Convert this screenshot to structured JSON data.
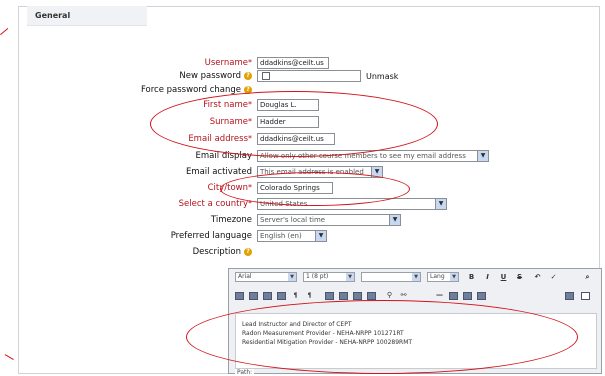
{
  "section": {
    "title": "General"
  },
  "fields": {
    "username": {
      "label": "Username",
      "value": "ddadkins@ceilt.us"
    },
    "new_password": {
      "label": "New password",
      "unmask_label": "Unmask"
    },
    "force_password_change": {
      "label": "Force password change"
    },
    "first_name": {
      "label": "First name",
      "value": "Douglas L."
    },
    "surname": {
      "label": "Surname",
      "value": "Hadder"
    },
    "email_address": {
      "label": "Email address",
      "value": "ddadkins@ceilt.us"
    },
    "email_display": {
      "label": "Email display",
      "value": "Allow only other course members to see my email address"
    },
    "email_activated": {
      "label": "Email activated",
      "value": "This email address is enabled"
    },
    "city_town": {
      "label": "City/town",
      "value": "Colorado Springs"
    },
    "country": {
      "label": "Select a country",
      "value": "United States"
    },
    "timezone": {
      "label": "Timezone",
      "value": "Server's local time"
    },
    "preferred_language": {
      "label": "Preferred language",
      "value": "English (en)"
    },
    "description": {
      "label": "Description"
    }
  },
  "editor": {
    "font_family": "Arial",
    "font_size": "1 (8 pt)",
    "style": "",
    "lang": "Lang",
    "lines": [
      "Lead Instructor and Director of CEPT",
      "Radon Measurement Provider - NEHA-NRPP 101271RT",
      "Residential Mitigation Provider - NEHA-NRPP 100289RMT"
    ],
    "path": "Path:"
  },
  "colors": {
    "required_label": "#b3121b",
    "annotation": "#d2141b",
    "help_icon": "#e3a000"
  }
}
